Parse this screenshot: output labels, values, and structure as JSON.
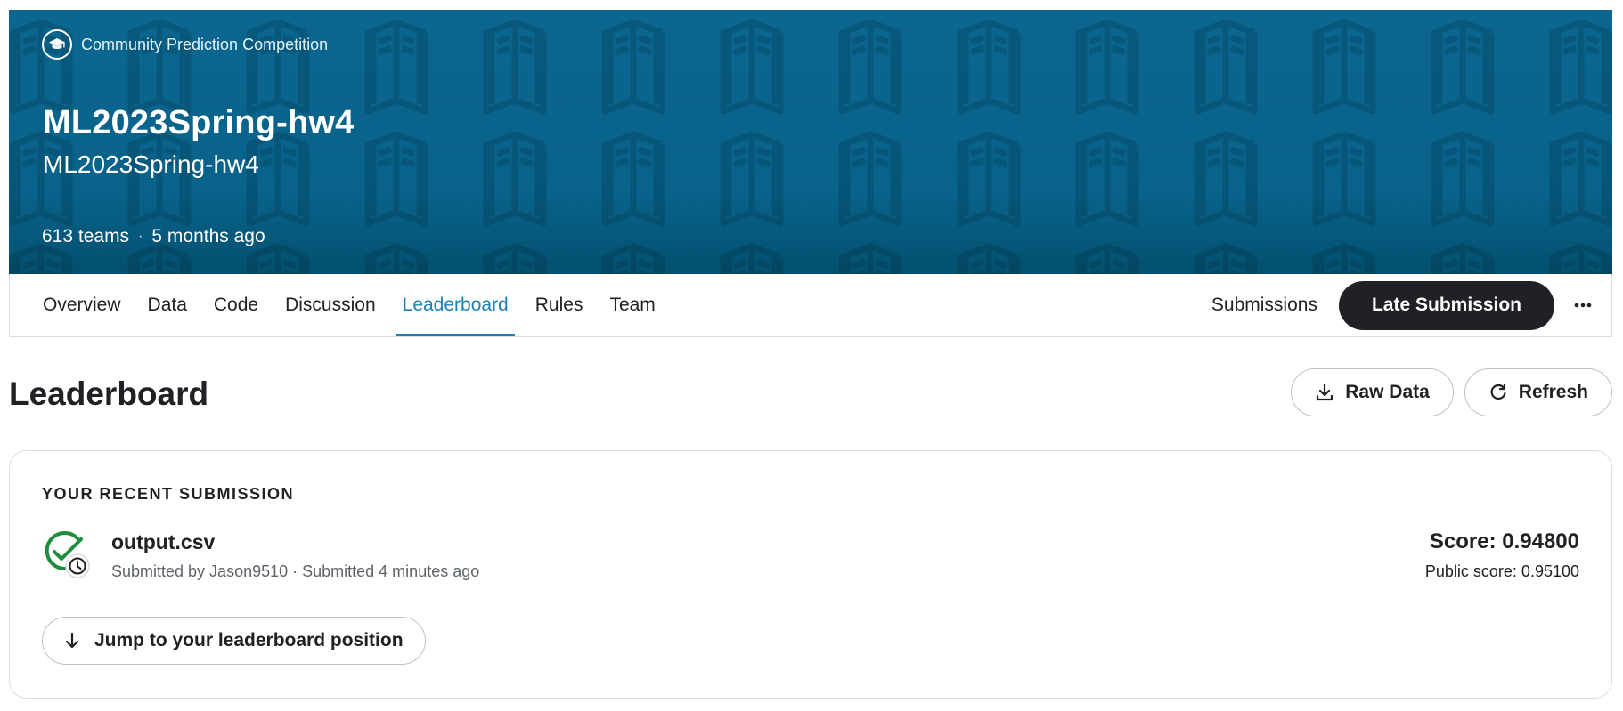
{
  "banner": {
    "competition_type": "Community Prediction Competition",
    "competition_type_icon": "graduation-cap-icon",
    "title": "ML2023Spring-hw4",
    "subtitle": "ML2023Spring-hw4",
    "teams": "613 teams",
    "separator": "·",
    "age": "5 months ago",
    "background_color": "#0b6790"
  },
  "tabs": [
    {
      "label": "Overview",
      "active": false
    },
    {
      "label": "Data",
      "active": false
    },
    {
      "label": "Code",
      "active": false
    },
    {
      "label": "Discussion",
      "active": false
    },
    {
      "label": "Leaderboard",
      "active": true
    },
    {
      "label": "Rules",
      "active": false
    },
    {
      "label": "Team",
      "active": false
    }
  ],
  "tabbar_right": {
    "submissions_label": "Submissions",
    "late_submission_label": "Late Submission",
    "more_icon": "more-horizontal-icon"
  },
  "leaderboard": {
    "title": "Leaderboard",
    "raw_data_label": "Raw Data",
    "raw_data_icon": "download-icon",
    "refresh_label": "Refresh",
    "refresh_icon": "refresh-icon"
  },
  "recent_submission": {
    "heading": "YOUR RECENT SUBMISSION",
    "status_icon": "check-circle-clock-icon",
    "file_name": "output.csv",
    "meta": "Submitted by Jason9510 · Submitted 4 minutes ago",
    "score": "Score: 0.94800",
    "public_score": "Public score: 0.95100",
    "jump_label": "Jump to your leaderboard position",
    "jump_icon": "arrow-down-icon"
  },
  "colors": {
    "accent": "#1d7fb3",
    "success": "#1e8e3e",
    "primary_button": "#202124"
  }
}
